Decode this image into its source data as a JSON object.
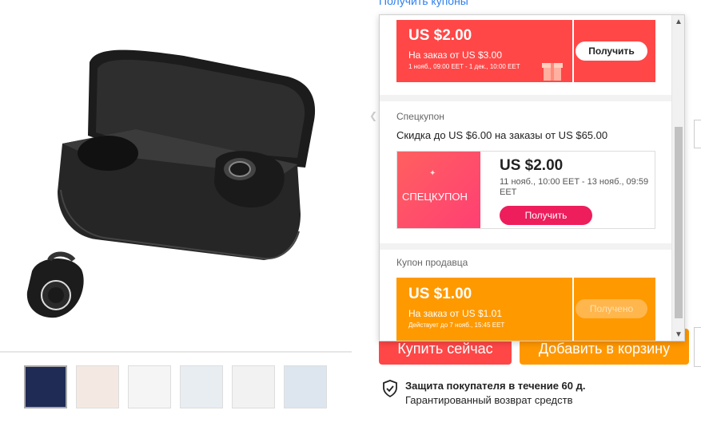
{
  "coupon_link": "Получить купоны",
  "thumbnails_count": 7,
  "buttons": {
    "buy_now": "Купить сейчас",
    "add_to_cart": "Добавить в корзину"
  },
  "protection": {
    "title": "Защита покупателя в течение 60 д.",
    "subtitle": "Гарантированный возврат средств"
  },
  "popup": {
    "coupon1": {
      "amount": "US $2.00",
      "condition": "На заказ от US $3.00",
      "dates": "1 нояб., 09:00 EET - 1 дек., 10:00 EET",
      "button": "Получить"
    },
    "special_section": {
      "label": "Спецкупон",
      "description": "Скидка до US $6.00 на заказы от US $65.00",
      "badge": "СПЕЦКУПОН",
      "amount": "US $2.00",
      "dates": "11 нояб., 10:00 EET - 13 нояб., 09:59 EET",
      "button": "Получить"
    },
    "seller_section": {
      "label": "Купон продавца",
      "amount": "US $1.00",
      "condition": "На заказ от US $1.01",
      "validity": "Действует до 7 нояб., 15:45 EET",
      "button": "Получено"
    }
  },
  "colors": {
    "red": "#ff4747",
    "orange": "#ff9900",
    "pink": "#ee1d5c",
    "link": "#2f80ed"
  }
}
